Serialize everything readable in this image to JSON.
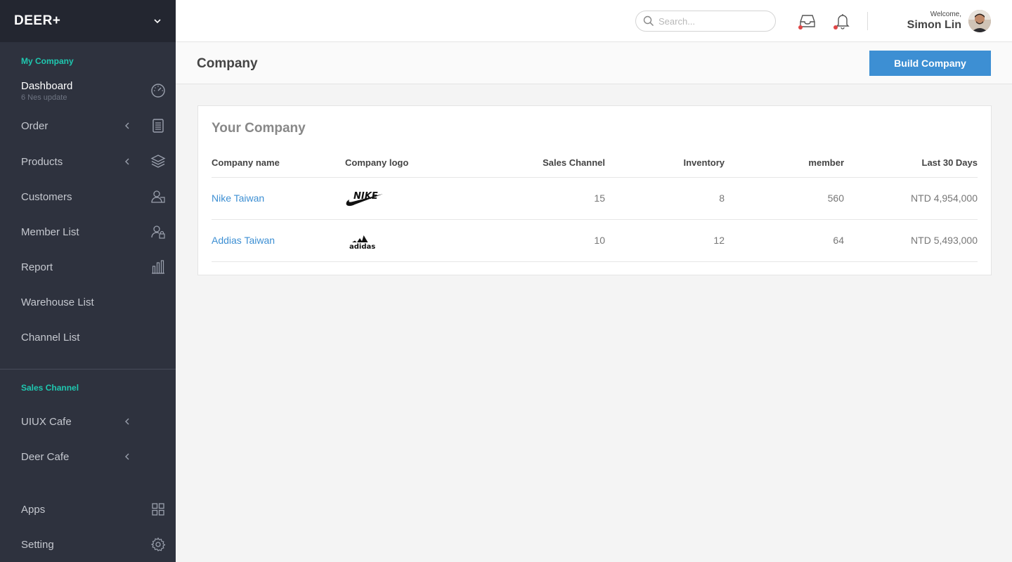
{
  "brand": {
    "name": "DEER+"
  },
  "sidebar": {
    "section1_title": "My Company",
    "dashboard": {
      "label": "Dashboard",
      "sub": "6 Nes update",
      "icon": "speedometer-icon"
    },
    "items": [
      {
        "label": "Order",
        "icon": "document-icon",
        "has_chevron": true
      },
      {
        "label": "Products",
        "icon": "box-icon",
        "has_chevron": true
      },
      {
        "label": "Customers",
        "icon": "users-icon",
        "has_chevron": false
      },
      {
        "label": "Member List",
        "icon": "user-lock-icon",
        "has_chevron": false
      },
      {
        "label": "Report",
        "icon": "bar-chart-icon",
        "has_chevron": false
      },
      {
        "label": "Warehouse List",
        "icon": "",
        "has_chevron": false
      },
      {
        "label": "Channel List",
        "icon": "",
        "has_chevron": false
      }
    ],
    "section2_title": "Sales Channel",
    "channels": [
      {
        "label": "UIUX Cafe",
        "has_chevron": true
      },
      {
        "label": "Deer Cafe",
        "has_chevron": true
      }
    ],
    "bottom": [
      {
        "label": "Apps",
        "icon": "grid-icon"
      },
      {
        "label": "Setting",
        "icon": "gear-icon"
      }
    ]
  },
  "topbar": {
    "search_placeholder": "Search...",
    "welcome": "Welcome,",
    "user_name": "Simon Lin",
    "notification_color": "#e04646"
  },
  "page": {
    "title": "Company",
    "build_button": "Build Company"
  },
  "card": {
    "title": "Your Company",
    "columns": [
      "Company name",
      "Company logo",
      "Sales Channel",
      "Inventory",
      "member",
      "Last 30 Days"
    ],
    "rows": [
      {
        "name": "Nike Taiwan",
        "logo": "nike-logo",
        "logo_text": "NIKE",
        "sales_channel": "15",
        "inventory": "8",
        "member": "560",
        "last30": "NTD 4,954,000"
      },
      {
        "name": "Addias Taiwan",
        "logo": "adidas-logo",
        "logo_text": "adidas",
        "sales_channel": "10",
        "inventory": "12",
        "member": "64",
        "last30": "NTD 5,493,000"
      }
    ]
  },
  "colors": {
    "accent": "#3d8fd3",
    "section_title": "#1fc8b0",
    "sidebar_bg": "#2e323e"
  }
}
